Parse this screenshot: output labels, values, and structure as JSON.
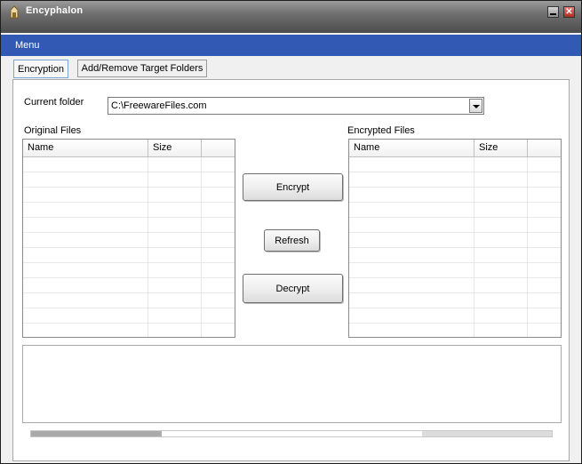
{
  "window": {
    "title": "Encyphalon",
    "minimize_icon": "minimize-icon",
    "close_icon": "close-icon"
  },
  "menu": {
    "items": [
      "Menu"
    ]
  },
  "tabs": [
    {
      "label": "Encryption",
      "active": true
    },
    {
      "label": "Add/Remove Target Folders",
      "active": false
    }
  ],
  "folder": {
    "label": "Current folder",
    "value": "C:\\FreewareFiles.com"
  },
  "original_files": {
    "title": "Original Files",
    "columns": [
      "Name",
      "Size"
    ],
    "rows": []
  },
  "encrypted_files": {
    "title": "Encrypted Files",
    "columns": [
      "Name",
      "Size"
    ],
    "rows": []
  },
  "actions": {
    "encrypt": "Encrypt",
    "refresh": "Refresh",
    "decrypt": "Decrypt"
  },
  "log": {
    "text": ""
  },
  "colors": {
    "menubar": "#3259b4",
    "titlebar": "#5a5a5a"
  }
}
